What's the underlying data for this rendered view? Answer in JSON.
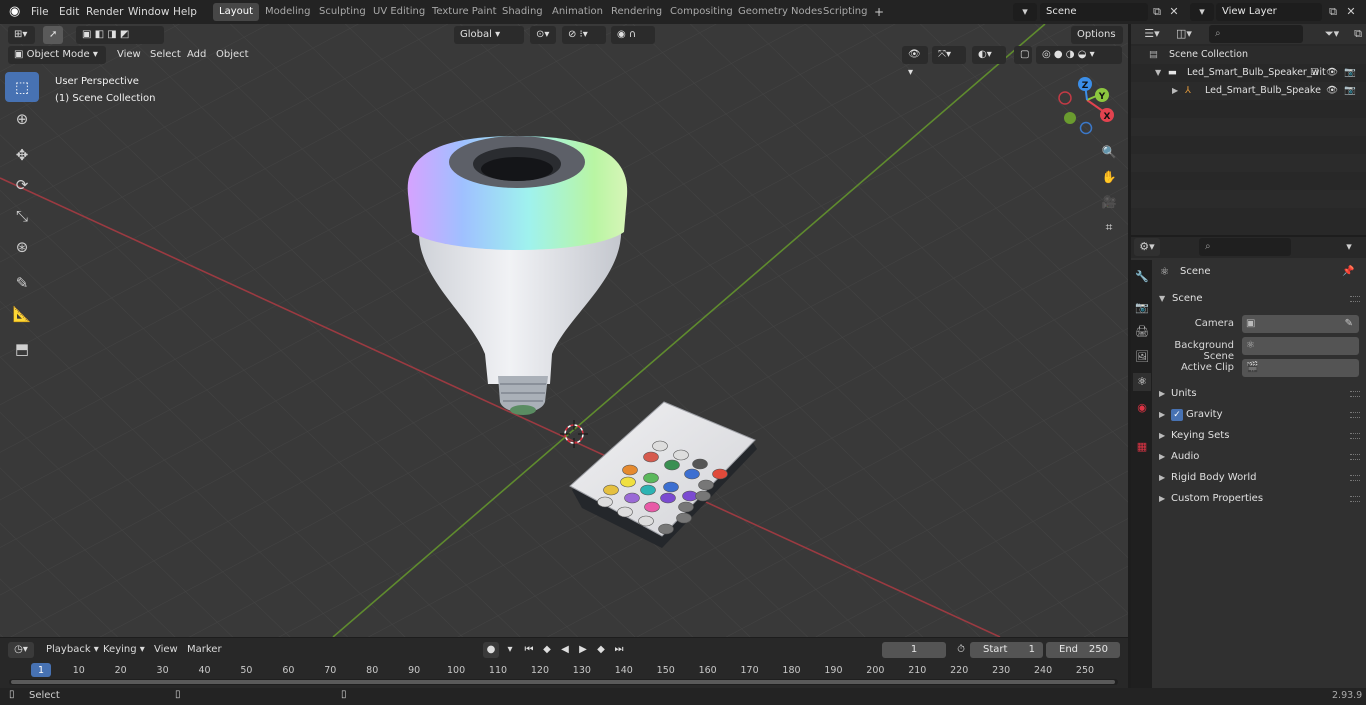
{
  "topbar": {
    "menus": [
      "File",
      "Edit",
      "Render",
      "Window",
      "Help"
    ],
    "workspace_tabs": [
      "Layout",
      "Modeling",
      "Sculpting",
      "UV Editing",
      "Texture Paint",
      "Shading",
      "Animation",
      "Rendering",
      "Compositing",
      "Geometry Nodes",
      "Scripting"
    ],
    "active_tab": "Layout",
    "add_tab": "+",
    "scene_name": "Scene",
    "view_layer": "View Layer"
  },
  "viewport_header": {
    "mode": "Object Mode",
    "menus": [
      "View",
      "Select",
      "Add",
      "Object"
    ],
    "orientation": "Global",
    "options": "Options"
  },
  "viewport": {
    "perspective": "User Perspective",
    "collection": "(1) Scene Collection",
    "gizmo_axes": [
      "X",
      "Y",
      "Z"
    ]
  },
  "outliner": {
    "root": "Scene Collection",
    "items": [
      {
        "name": "Led_Smart_Bulb_Speaker_wit"
      },
      {
        "name": "Led_Smart_Bulb_Speake"
      }
    ]
  },
  "properties": {
    "context": "Scene",
    "section": "Scene",
    "fields": [
      {
        "label": "Camera",
        "value": ""
      },
      {
        "label": "Background Scene",
        "value": ""
      },
      {
        "label": "Active Clip",
        "value": ""
      }
    ],
    "panels": [
      "Units",
      "Gravity",
      "Keying Sets",
      "Audio",
      "Rigid Body World",
      "Custom Properties"
    ],
    "gravity_enabled": true
  },
  "timeline": {
    "menus": [
      "Playback",
      "Keying",
      "View",
      "Marker"
    ],
    "current_frame": "1",
    "start_label": "Start",
    "start": "1",
    "end_label": "End",
    "end": "250",
    "ruler": [
      "1",
      "10",
      "20",
      "30",
      "40",
      "50",
      "60",
      "70",
      "80",
      "90",
      "100",
      "110",
      "120",
      "130",
      "140",
      "150",
      "160",
      "170",
      "180",
      "190",
      "200",
      "210",
      "220",
      "230",
      "240",
      "250"
    ]
  },
  "statusbar": {
    "left": "Select",
    "version": "2.93.9"
  },
  "colors": {
    "accent": "#4772b3",
    "x_axis": "#e2434f",
    "y_axis": "#8cc63f",
    "z_axis": "#3b8ee8"
  }
}
